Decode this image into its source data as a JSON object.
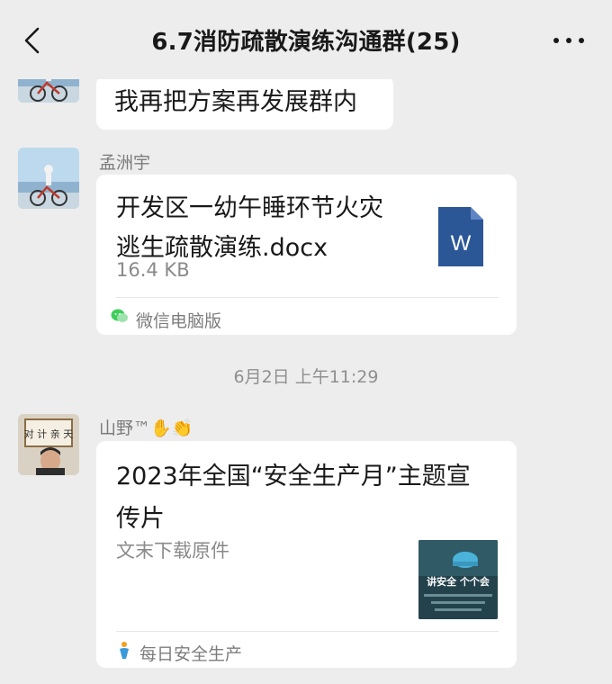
{
  "header": {
    "title": "6.7消防疏散演练沟通群(25)"
  },
  "messages": [
    {
      "text": "我再把方案再发展群内"
    },
    {
      "sender": "孟洲宇",
      "file_name_line1": "开发区一幼午睡环节火灾",
      "file_name_line2": "逃生疏散演练.docx",
      "file_size": "16.4 KB",
      "file_icon_letter": "W",
      "source": "微信电脑版"
    },
    {
      "timestamp": "6月2日 上午11:29"
    },
    {
      "sender": "山野™✋👏",
      "title_line1": "2023年全国“安全生产月”主题宣",
      "title_line2": "传片",
      "description": "文末下载原件",
      "thumb_text_large": "讲安全   个个会",
      "source": "每日安全生产"
    }
  ],
  "colors": {
    "background": "#ededed",
    "bubble": "#ffffff",
    "word_blue": "#2b5797"
  }
}
